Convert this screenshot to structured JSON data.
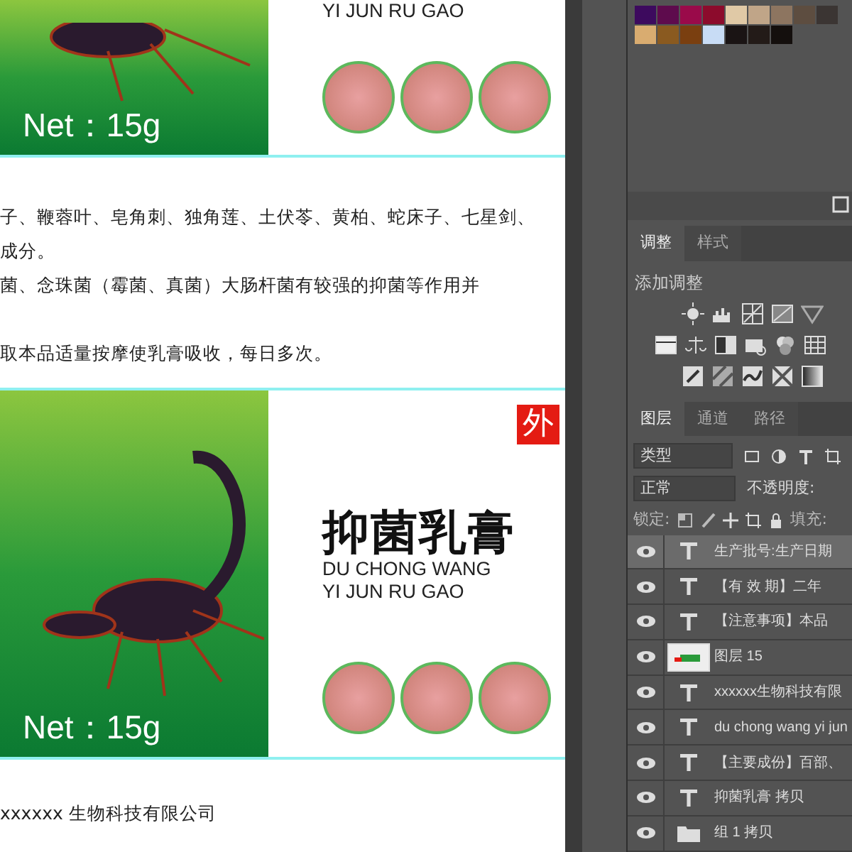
{
  "canvas": {
    "top_label": {
      "pinyin": "YI JUN RU GAO",
      "net": "Net：15g"
    },
    "text_lines": [
      "子、鞭蓉叶、皂角刺、独角莲、土伏苓、黄柏、蛇床子、七星剑、",
      "成分。",
      "菌、念珠菌（霉菌、真菌）大肠杆菌有较强的抑菌等作用并",
      "取本品适量按摩使乳膏吸收，每日多次。"
    ],
    "label": {
      "badge": "外",
      "title": "抑菌乳膏",
      "pinyin": [
        "DU CHONG WANG",
        "YI JUN RU GAO"
      ],
      "net": "Net：15g"
    },
    "bottom_line": "xxxxxx 生物科技有限公司"
  },
  "swatches": [
    {
      "color": "#3d0a5e"
    },
    {
      "color": "#5e0b4d"
    },
    {
      "color": "#9a0a4a"
    },
    {
      "color": "#8c0b2c"
    },
    {
      "color": "#e0c9a6"
    },
    {
      "color": "#c0a588"
    },
    {
      "color": "#8d7560"
    },
    {
      "color": "#5d4d40"
    },
    {
      "color": "#3b3533"
    },
    {
      "color": "#d9ac70"
    },
    {
      "color": "#8a5a20"
    },
    {
      "color": "#7a3f10"
    },
    {
      "color": "#c8dcf5"
    },
    {
      "color": "#1a1414"
    },
    {
      "color": "#231b18"
    },
    {
      "color": "#140f0d"
    }
  ],
  "adjust_panel": {
    "tabs": [
      {
        "label": "调整",
        "selected": true
      },
      {
        "label": "样式",
        "selected": false
      }
    ],
    "heading": "添加调整"
  },
  "layers_panel": {
    "tabs": [
      {
        "label": "图层",
        "selected": true
      },
      {
        "label": "通道",
        "selected": false
      },
      {
        "label": "路径",
        "selected": false
      }
    ],
    "filter": "类型",
    "blend_mode": "正常",
    "opacity_label": "不透明度:",
    "lock_label": "锁定:",
    "fill_label": "填充:",
    "layers": [
      {
        "kind": "text",
        "name": "生产批号:生产日期",
        "visible": true,
        "selected": true
      },
      {
        "kind": "text",
        "name": "【有 效 期】二年",
        "visible": true,
        "selected": false
      },
      {
        "kind": "text",
        "name": "【注意事项】本品",
        "visible": true,
        "selected": false
      },
      {
        "kind": "image",
        "name": "图层 15",
        "visible": true,
        "selected": false
      },
      {
        "kind": "text",
        "name": "xxxxxx生物科技有限",
        "visible": true,
        "selected": false
      },
      {
        "kind": "text",
        "name": "du chong wang yi jun",
        "visible": true,
        "selected": false
      },
      {
        "kind": "text",
        "name": "【主要成份】百部、",
        "visible": true,
        "selected": false
      },
      {
        "kind": "text",
        "name": "抑菌乳膏 拷贝",
        "visible": true,
        "selected": false
      },
      {
        "kind": "group",
        "name": "组 1 拷贝",
        "visible": true,
        "selected": false
      }
    ]
  }
}
